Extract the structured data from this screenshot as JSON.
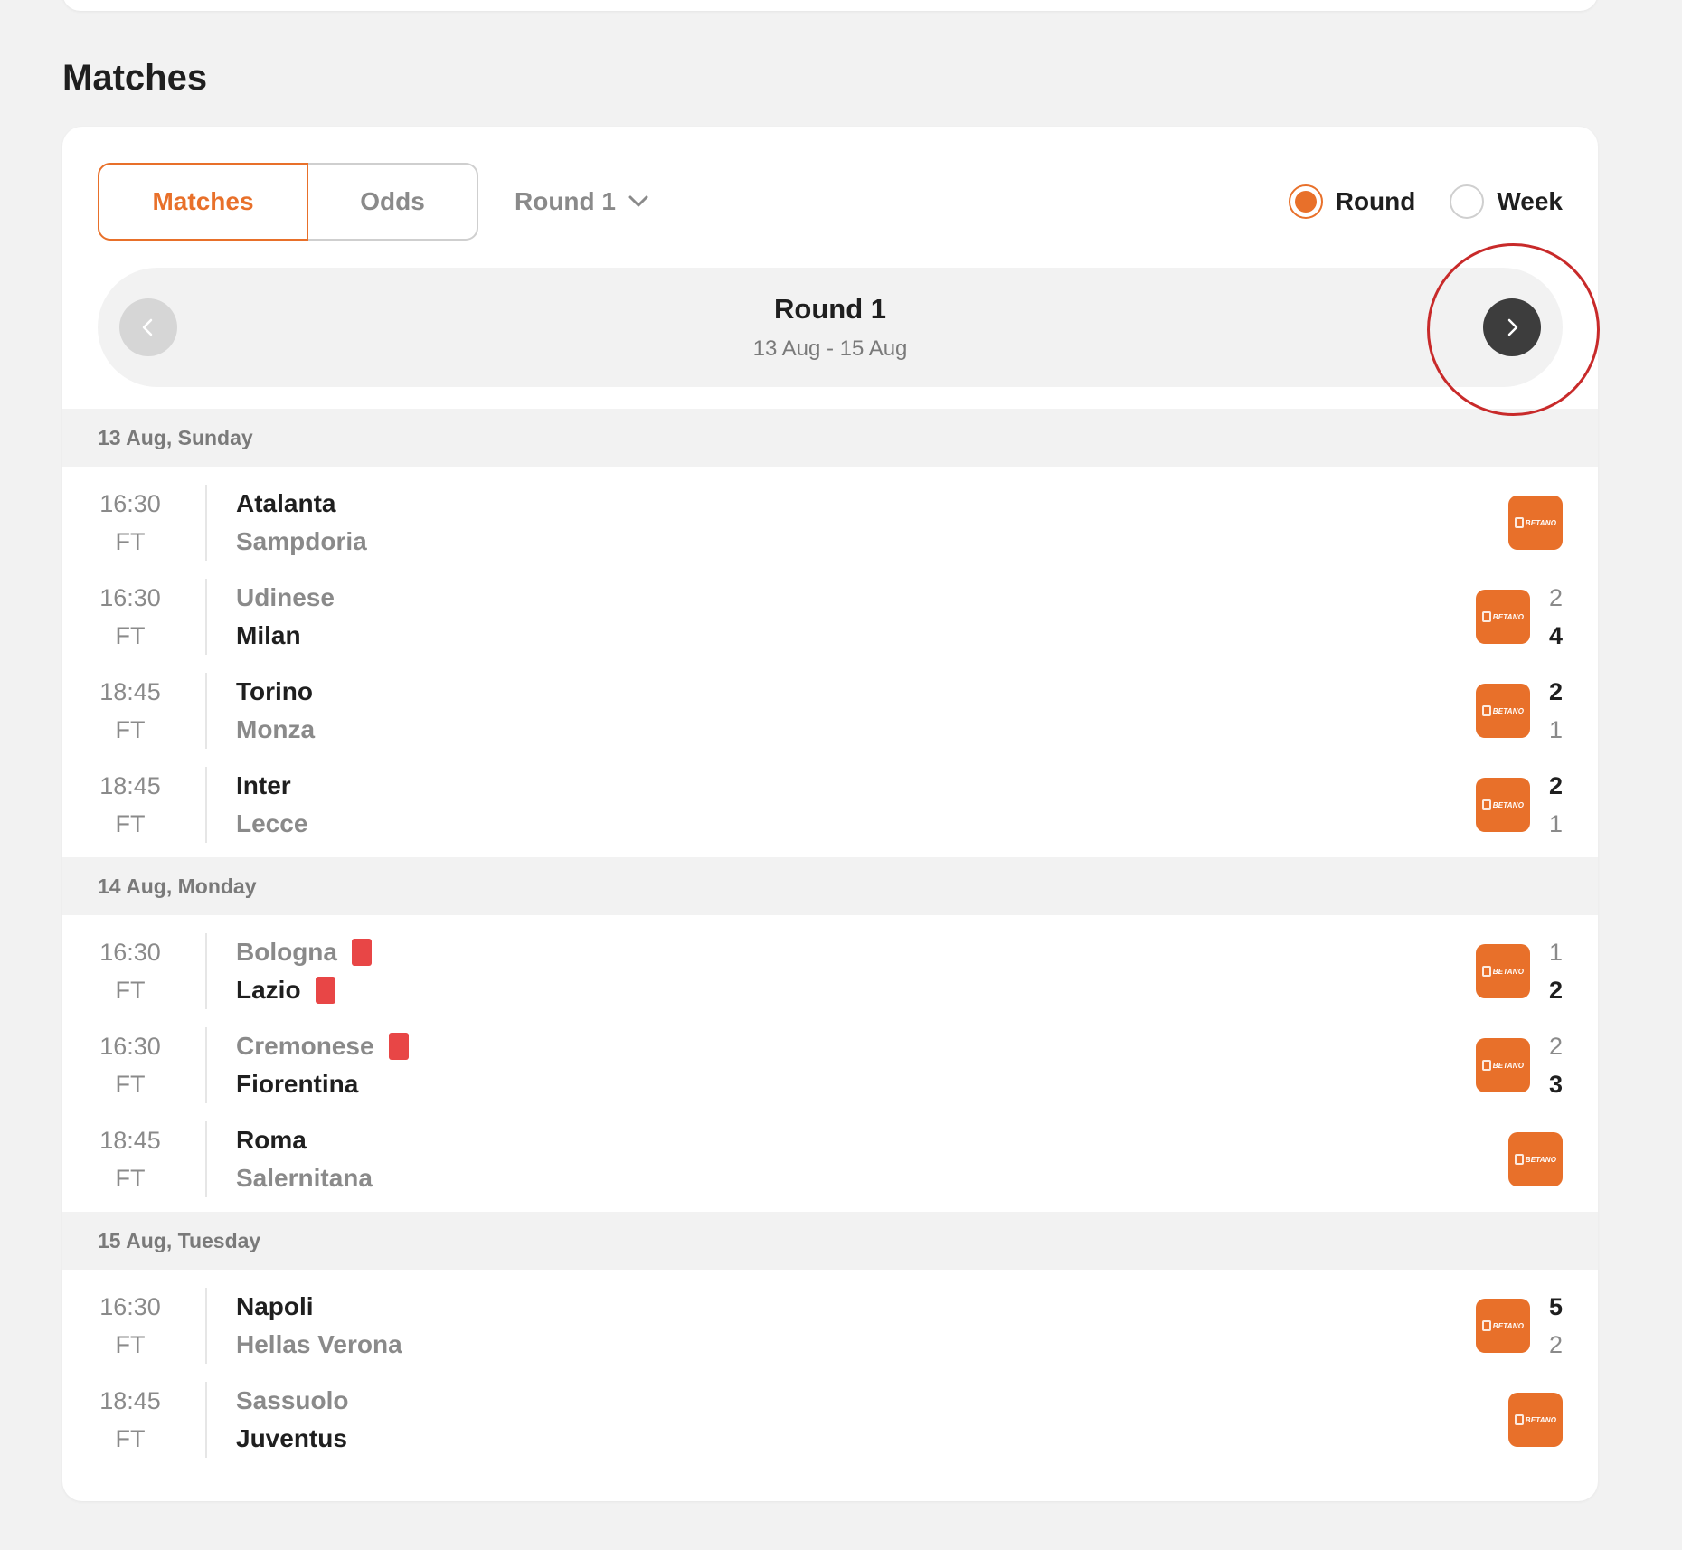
{
  "section_title": "Matches",
  "tabs": {
    "matches": "Matches",
    "odds": "Odds"
  },
  "round_select": {
    "label": "Round 1"
  },
  "view_toggle": {
    "round": "Round",
    "week": "Week",
    "selected": "Round"
  },
  "round_nav": {
    "title": "Round 1",
    "range": "13 Aug - 15 Aug"
  },
  "colors": {
    "accent": "#e8702a",
    "red_card": "#e84646",
    "highlight": "#c82a2a"
  },
  "days": [
    {
      "label": "13 Aug, Sunday",
      "matches": [
        {
          "time": "16:30",
          "status": "FT",
          "home": "Atalanta",
          "away": "Sampdoria",
          "home_score": "",
          "away_score": "",
          "home_red": false,
          "away_red": false
        },
        {
          "time": "16:30",
          "status": "FT",
          "home": "Udinese",
          "away": "Milan",
          "home_score": "2",
          "away_score": "4",
          "home_red": false,
          "away_red": false
        },
        {
          "time": "18:45",
          "status": "FT",
          "home": "Torino",
          "away": "Monza",
          "home_score": "2",
          "away_score": "1",
          "home_red": false,
          "away_red": false
        },
        {
          "time": "18:45",
          "status": "FT",
          "home": "Inter",
          "away": "Lecce",
          "home_score": "2",
          "away_score": "1",
          "home_red": false,
          "away_red": false
        }
      ]
    },
    {
      "label": "14 Aug, Monday",
      "matches": [
        {
          "time": "16:30",
          "status": "FT",
          "home": "Bologna",
          "away": "Lazio",
          "home_score": "1",
          "away_score": "2",
          "home_red": true,
          "away_red": true
        },
        {
          "time": "16:30",
          "status": "FT",
          "home": "Cremonese",
          "away": "Fiorentina",
          "home_score": "2",
          "away_score": "3",
          "home_red": true,
          "away_red": false
        },
        {
          "time": "18:45",
          "status": "FT",
          "home": "Roma",
          "away": "Salernitana",
          "home_score": "",
          "away_score": "",
          "home_red": false,
          "away_red": false
        }
      ]
    },
    {
      "label": "15 Aug, Tuesday",
      "matches": [
        {
          "time": "16:30",
          "status": "FT",
          "home": "Napoli",
          "away": "Hellas Verona",
          "home_score": "5",
          "away_score": "2",
          "home_red": false,
          "away_red": false
        },
        {
          "time": "18:45",
          "status": "FT",
          "home": "Sassuolo",
          "away": "Juventus",
          "home_score": "",
          "away_score": "",
          "home_red": false,
          "away_red": false
        }
      ]
    }
  ],
  "sponsor_label": "BETANO"
}
